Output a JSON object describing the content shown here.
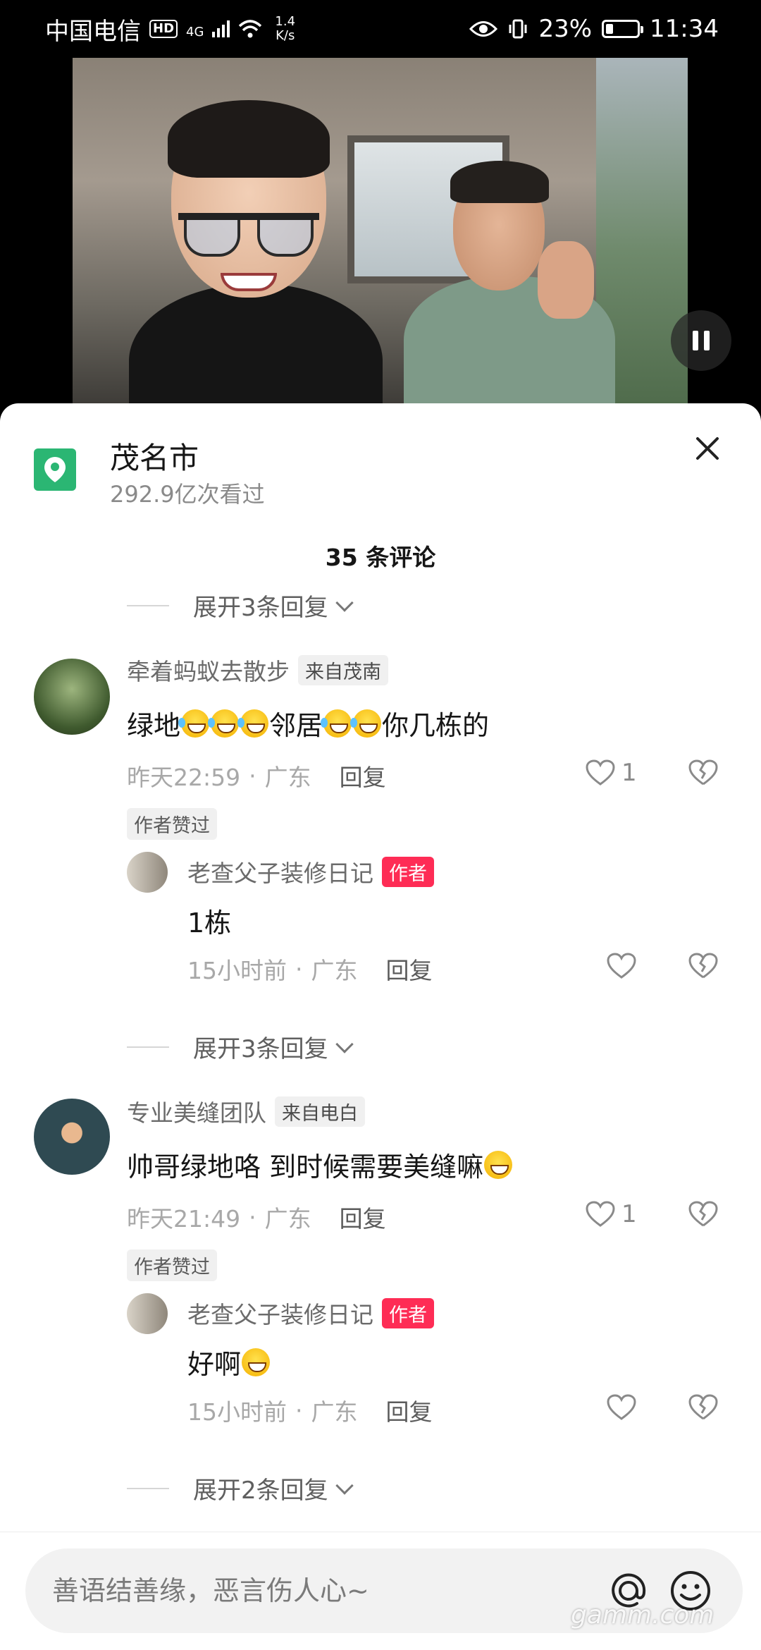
{
  "status_bar": {
    "carrier": "中国电信",
    "hd": "HD",
    "network": "4G",
    "speed_value": "1.4",
    "speed_unit": "K/s",
    "battery": "23%",
    "battery_level": 0.23,
    "time": "11:34"
  },
  "location": {
    "title": "茂名市",
    "views": "292.9亿次看过"
  },
  "comments_header": "35 条评论",
  "expand_top": "展开3条回复",
  "comments": [
    {
      "username": "牵着蚂蚁去散步",
      "origin": "来自茂南",
      "text_parts": [
        "绿地",
        "邻居",
        "你几栋的"
      ],
      "time": "昨天22:59",
      "region": "广东",
      "reply_label": "回复",
      "likes": "1",
      "author_liked": "作者赞过",
      "reply": {
        "username": "老查父子装修日记",
        "badge": "作者",
        "text": "1栋",
        "time": "15小时前",
        "region": "广东",
        "reply_label": "回复"
      },
      "expand": "展开3条回复"
    },
    {
      "username": "专业美缝团队",
      "origin": "来自电白",
      "text": "帅哥绿地咯 到时候需要美缝嘛",
      "time": "昨天21:49",
      "region": "广东",
      "reply_label": "回复",
      "likes": "1",
      "author_liked": "作者赞过",
      "reply": {
        "username": "老查父子装修日记",
        "badge": "作者",
        "text": "好啊",
        "time": "15小时前",
        "region": "广东",
        "reply_label": "回复"
      },
      "expand": "展开2条回复"
    }
  ],
  "input": {
    "placeholder": "善语结善缘，恶言伤人心~"
  },
  "watermark": "gamm.com",
  "colors": {
    "accent": "#fe2c55",
    "location_icon": "#2bb673"
  },
  "icons": [
    "location-pin-icon",
    "close-icon",
    "heart-icon",
    "broken-heart-icon",
    "at-icon",
    "emoji-icon",
    "pause-icon",
    "chevron-down-icon"
  ]
}
